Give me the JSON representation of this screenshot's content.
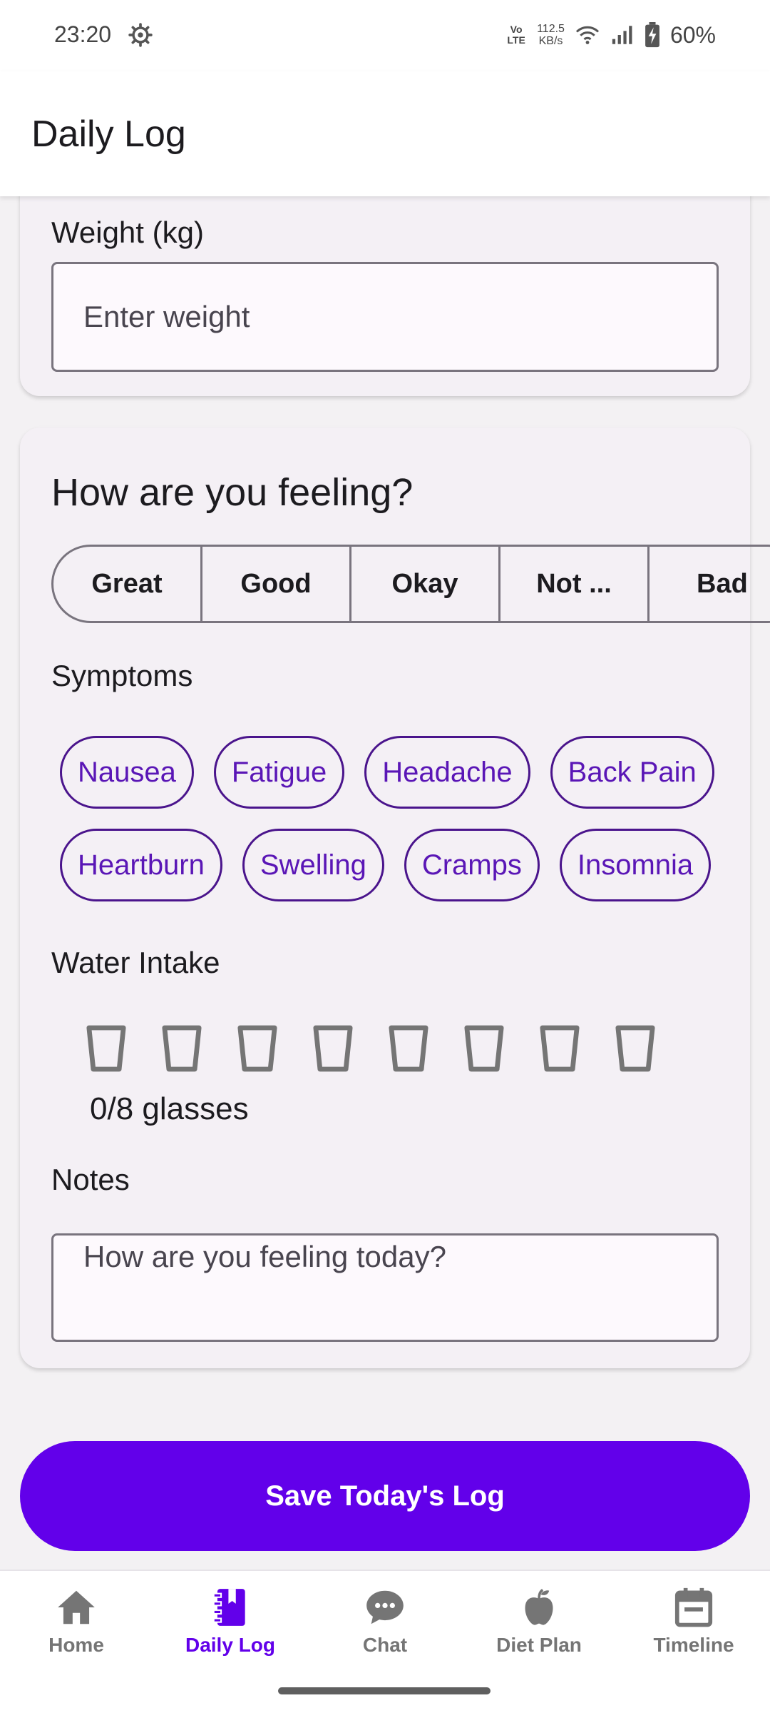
{
  "status_bar": {
    "time": "23:20",
    "volte": "Vo LTE",
    "net_speed_value": "112.5",
    "net_speed_unit": "KB/s",
    "battery": "60%"
  },
  "app_bar": {
    "title": "Daily Log"
  },
  "weight": {
    "label": "Weight (kg)",
    "placeholder": "Enter weight"
  },
  "mood": {
    "title": "How are you feeling?",
    "options": [
      "Great",
      "Good",
      "Okay",
      "Not ...",
      "Bad"
    ]
  },
  "symptoms": {
    "label": "Symptoms",
    "chips": [
      "Nausea",
      "Fatigue",
      "Headache",
      "Back Pain",
      "Heartburn",
      "Swelling",
      "Cramps",
      "Insomnia"
    ]
  },
  "water": {
    "label": "Water Intake",
    "glasses_filled": 0,
    "glasses_total": 8,
    "count_text": "0/8 glasses"
  },
  "notes": {
    "label": "Notes",
    "placeholder": "How are you feeling today?"
  },
  "save_button": {
    "label": "Save Today's Log"
  },
  "bottom_nav": {
    "items": [
      {
        "label": "Home",
        "icon": "home-icon"
      },
      {
        "label": "Daily Log",
        "icon": "journal-icon",
        "active": true
      },
      {
        "label": "Chat",
        "icon": "chat-bubble-icon"
      },
      {
        "label": "Diet Plan",
        "icon": "apple-icon"
      },
      {
        "label": "Timeline",
        "icon": "calendar-icon"
      }
    ]
  },
  "colors": {
    "accent": "#6200ea",
    "chip_border": "#4a148c",
    "card_bg": "#f4f0f5",
    "page_bg": "#f3f1f3"
  }
}
